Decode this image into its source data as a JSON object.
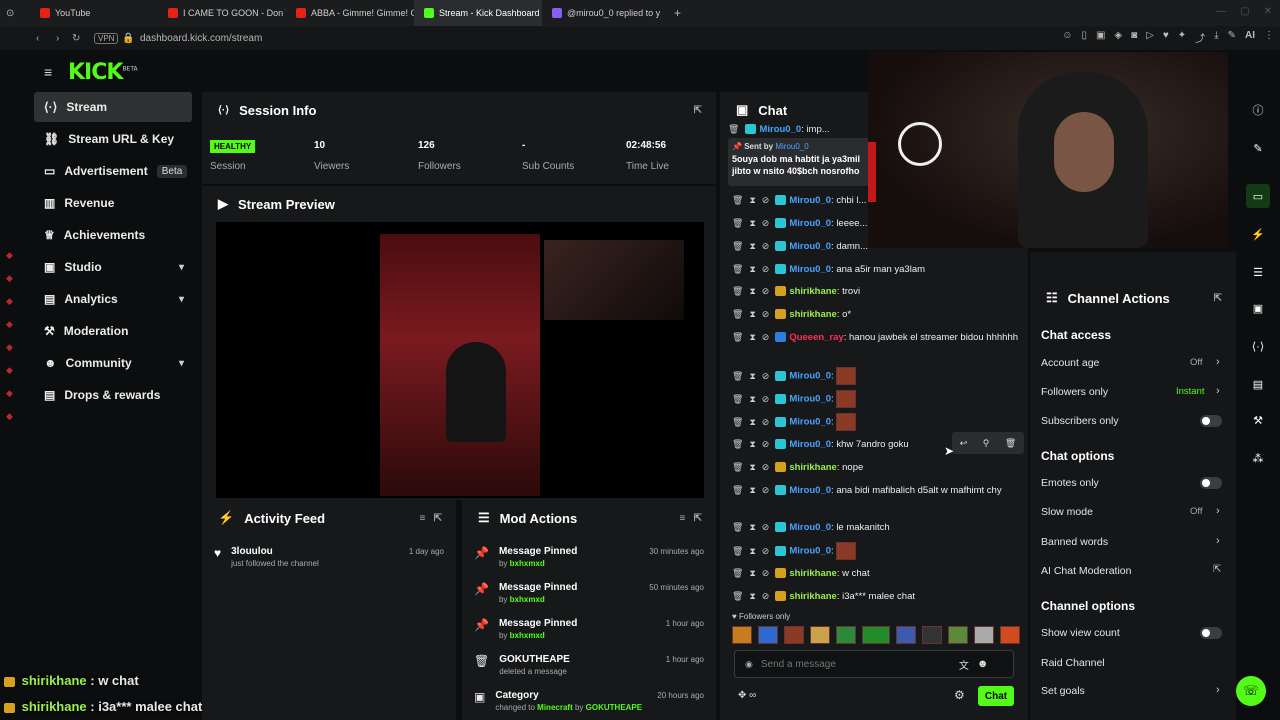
{
  "browser": {
    "tabs": [
      {
        "label": "YouTube",
        "color": "#e62117"
      },
      {
        "label": "I CAME TO GOON - Don To",
        "color": "#e62117"
      },
      {
        "label": "ABBA - Gimme! Gimme! Gi",
        "color": "#e62117"
      },
      {
        "label": "Stream - Kick Dashboard",
        "color": "#53fc18"
      },
      {
        "label": "@mirou0_0 replied to y",
        "color": "#8b5cf6"
      }
    ],
    "url": "dashboard.kick.com/stream",
    "vpn": "VPN",
    "ai": "AI"
  },
  "nav": {
    "logo": "KICK",
    "logo_badge": "BETA",
    "items": [
      {
        "label": "Stream",
        "icon": "stream-icon",
        "glyph": "⟨·⟩"
      },
      {
        "label": "Stream URL & Key",
        "icon": "link-icon",
        "glyph": "🔗"
      },
      {
        "label": "Advertisement",
        "icon": "ad-icon",
        "glyph": "▭",
        "badge": "Beta"
      },
      {
        "label": "Revenue",
        "icon": "revenue-icon",
        "glyph": "▥"
      },
      {
        "label": "Achievements",
        "icon": "trophy-icon",
        "glyph": "🏆"
      },
      {
        "label": "Studio",
        "icon": "studio-icon",
        "glyph": "▣"
      },
      {
        "label": "Analytics",
        "icon": "analytics-icon",
        "glyph": "▤"
      },
      {
        "label": "Moderation",
        "icon": "moderation-icon",
        "glyph": "🔨"
      },
      {
        "label": "Community",
        "icon": "community-icon",
        "glyph": "👥"
      },
      {
        "label": "Drops & rewards",
        "icon": "drops-icon",
        "glyph": "▤"
      }
    ]
  },
  "session": {
    "title": "Session Info",
    "status": "HEALTHY",
    "status_label": "Session",
    "viewers": "10",
    "viewers_label": "Viewers",
    "followers": "126",
    "followers_label": "Followers",
    "subs": "-",
    "subs_label": "Sub Counts",
    "time": "02:48:56",
    "time_label": "Time Live"
  },
  "preview": {
    "title": "Stream Preview"
  },
  "activity": {
    "title": "Activity Feed",
    "items": [
      {
        "user": "3louulou",
        "desc": "just followed the channel",
        "when": "1 day ago"
      }
    ]
  },
  "mod": {
    "title": "Mod Actions",
    "items": [
      {
        "title": "Message Pinned",
        "by": "by",
        "user": "bxhxmxd",
        "when": "30 minutes ago"
      },
      {
        "title": "Message Pinned",
        "by": "by",
        "user": "bxhxmxd",
        "when": "50 minutes ago"
      },
      {
        "title": "Message Pinned",
        "by": "by",
        "user": "bxhxmxd",
        "when": "1 hour ago"
      },
      {
        "title": "GOKUTHEAPE",
        "by": "deleted a message",
        "user": "",
        "when": "1 hour ago"
      },
      {
        "title": "Category",
        "by": "changed to",
        "user": "Minecraft",
        "by2": "by",
        "user2": "GOKUTHEAPE",
        "when": "20 hours ago"
      }
    ]
  },
  "chat": {
    "title": "Chat",
    "pinned": {
      "by_label": "Sent by",
      "by": "Mirou0_0",
      "text": "5ouya dob ma habtit ja ya3mil jibto w nsito 40$bch nosrofho"
    },
    "top_line": {
      "user": "Mirou0_0",
      "text": "imp..."
    },
    "messages": [
      {
        "user": "Mirou0_0",
        "badge": "b1",
        "text": "chbi l..."
      },
      {
        "user": "Mirou0_0",
        "badge": "b1",
        "text": "leeee..."
      },
      {
        "user": "Mirou0_0",
        "badge": "b1",
        "text": "damn..."
      },
      {
        "user": "Mirou0_0",
        "badge": "b1",
        "text": "ana a5ir man ya3lam"
      },
      {
        "user": "shirikhane",
        "badge": "b2",
        "text": "trovi"
      },
      {
        "user": "shirikhane",
        "badge": "b2",
        "text": "o*"
      },
      {
        "user": "Queeen_ray",
        "badge": "b3",
        "text": "hanou jawbek el streamer bidou hhhhhh"
      },
      {
        "user": "Mirou0_0",
        "badge": "b1",
        "text": "",
        "emote": true
      },
      {
        "user": "Mirou0_0",
        "badge": "b1",
        "text": "",
        "emote": true
      },
      {
        "user": "Mirou0_0",
        "badge": "b1",
        "text": "",
        "emote": true
      },
      {
        "user": "Mirou0_0",
        "badge": "b1",
        "text": "khw 7andro goku"
      },
      {
        "user": "shirikhane",
        "badge": "b2",
        "text": "nope"
      },
      {
        "user": "Mirou0_0",
        "badge": "b1",
        "text": "ana bidi mafibalich d5alt w mafhimt chy"
      },
      {
        "user": "Mirou0_0",
        "badge": "b1",
        "text": "le makanitch"
      },
      {
        "user": "Mirou0_0",
        "badge": "b1",
        "text": "",
        "emote": true
      },
      {
        "user": "shirikhane",
        "badge": "b2",
        "text": "w chat"
      },
      {
        "user": "shirikhane",
        "badge": "b2",
        "text": "i3a*** malee chat"
      }
    ],
    "followers_only": "Followers only",
    "placeholder": "Send a message",
    "send": "Chat",
    "colors": {
      "Mirou0_0": "#4aa3ff",
      "shirikhane": "#9bf04a",
      "Queeen_ray": "#ff2d55"
    }
  },
  "actions": {
    "title": "Channel Actions",
    "access_title": "Chat access",
    "account_age": "Account age",
    "account_age_val": "Off",
    "followers_only": "Followers only",
    "followers_only_val": "Instant",
    "subscribers_only": "Subscribers only",
    "options_title": "Chat options",
    "emotes_only": "Emotes only",
    "slow_mode": "Slow mode",
    "slow_mode_val": "Off",
    "banned_words": "Banned words",
    "ai_mod": "AI Chat Moderation",
    "chan_title": "Channel options",
    "view_count": "Show view count",
    "raid": "Raid Channel",
    "goals": "Set goals"
  },
  "overlay": {
    "line1_user": "shirikhane",
    "line1_text": " : w chat",
    "line2_user": "shirikhane",
    "line2_text": " : i3a*** malee chat"
  }
}
